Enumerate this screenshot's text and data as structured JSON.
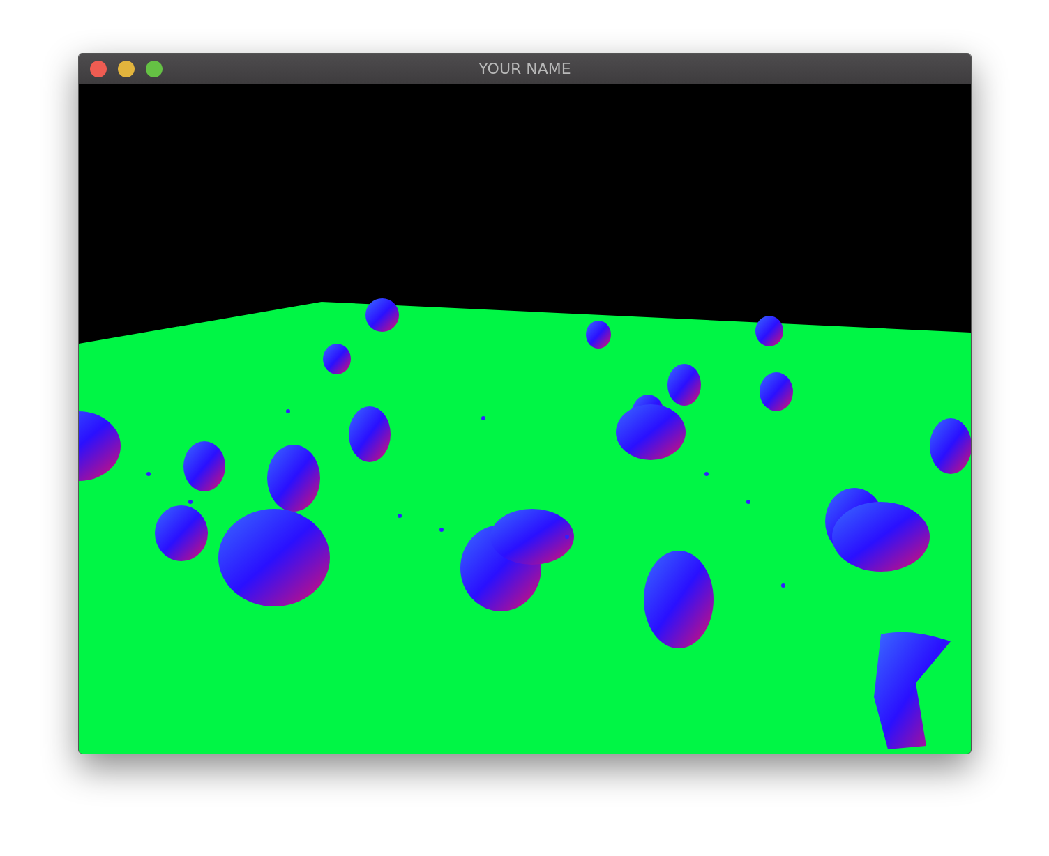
{
  "window": {
    "title": "YOUR NAME"
  }
}
